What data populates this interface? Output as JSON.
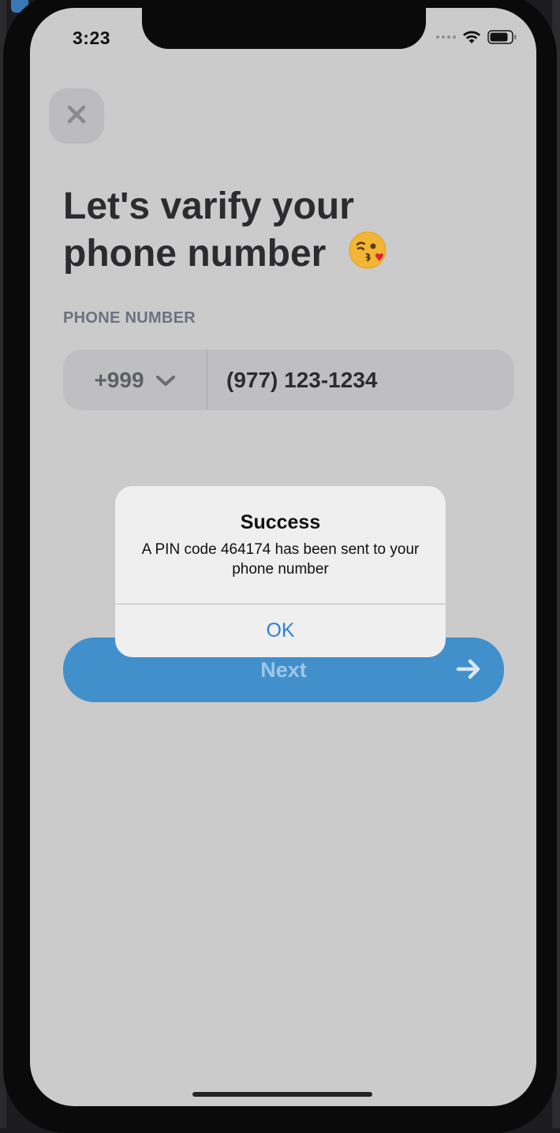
{
  "status_bar": {
    "time": "3:23",
    "signal_icon": "signal-dots-icon",
    "wifi_icon": "wifi-icon",
    "battery_icon": "battery-icon"
  },
  "header": {
    "close_icon": "close-icon"
  },
  "main": {
    "title_line1": "Let's varify your",
    "title_line2": "phone number",
    "title_emoji_icon": "kissing-face-emoji-icon",
    "phone_label": "PHONE NUMBER",
    "country_code": "+999",
    "chevron_icon": "chevron-down-icon",
    "phone_value": "(977) 123-1234",
    "next_label": "Next",
    "next_icon": "arrow-right-icon"
  },
  "alert": {
    "title": "Success",
    "message": "A PIN code 464174 has been sent to your phone number",
    "ok_label": "OK"
  },
  "colors": {
    "background": "#cbcbcc",
    "accent": "#4190cc",
    "alert_button": "#2f7fd6",
    "title_text": "#2c2c2f"
  }
}
